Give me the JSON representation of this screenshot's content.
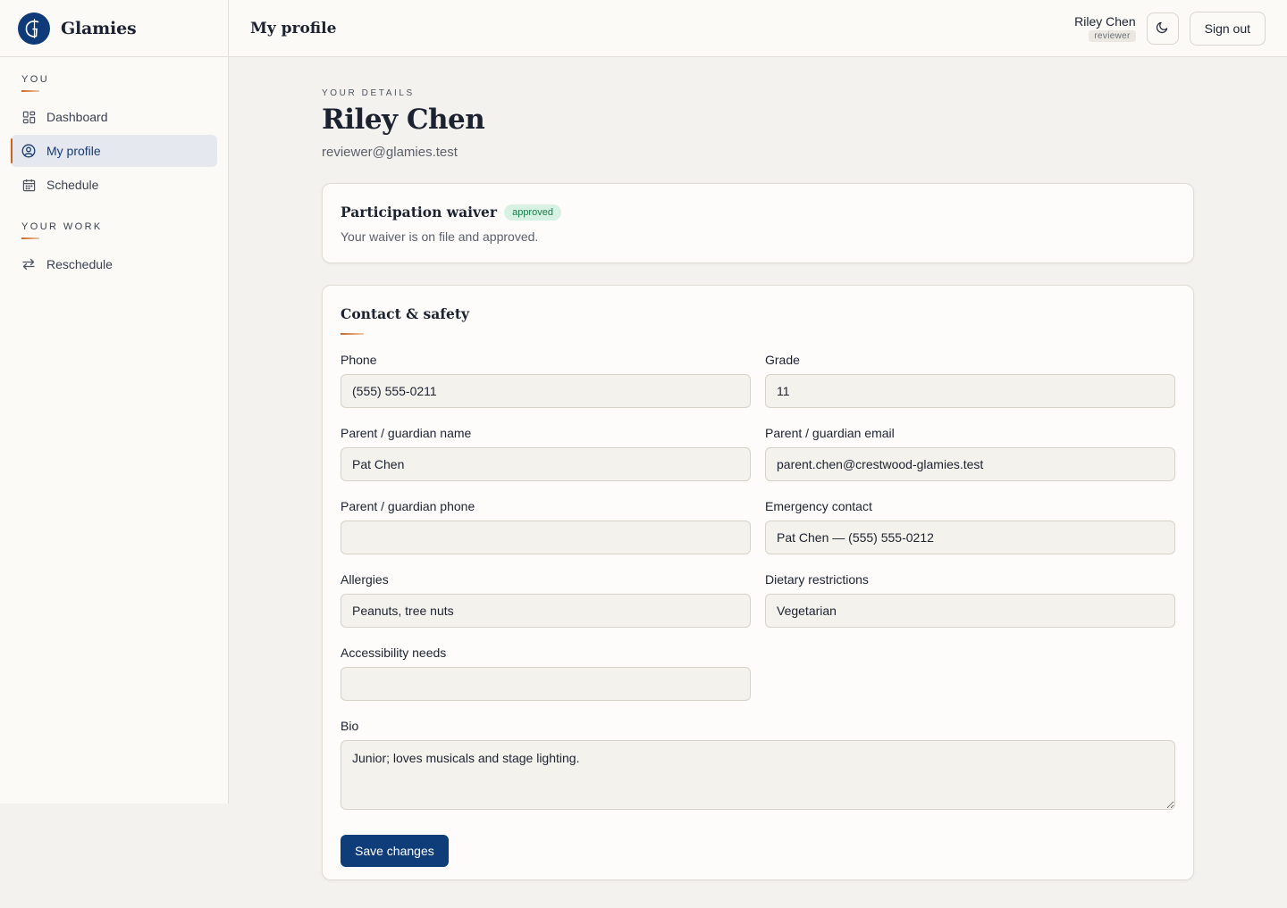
{
  "brand": {
    "name": "Glamies",
    "logo_letter": "G"
  },
  "sidebar": {
    "sections": [
      {
        "heading": "YOU",
        "items": [
          {
            "label": "Dashboard",
            "icon": "grid-icon",
            "active": false
          },
          {
            "label": "My profile",
            "icon": "user-circle-icon",
            "active": true
          },
          {
            "label": "Schedule",
            "icon": "calendar-icon",
            "active": false
          }
        ]
      },
      {
        "heading": "YOUR WORK",
        "items": [
          {
            "label": "Reschedule",
            "icon": "swap-arrows-icon",
            "active": false
          }
        ]
      }
    ]
  },
  "header": {
    "title": "My profile",
    "user_name": "Riley Chen",
    "user_role": "reviewer",
    "theme_icon": "moon-icon",
    "signout_label": "Sign out"
  },
  "main": {
    "eyebrow": "YOUR DETAILS",
    "name": "Riley Chen",
    "email": "reviewer@glamies.test",
    "waiver": {
      "title": "Participation waiver",
      "badge": "approved",
      "text": "Your waiver is on file and approved."
    },
    "contact": {
      "title": "Contact & safety",
      "fields": {
        "phone": {
          "label": "Phone",
          "value": "(555) 555-0211"
        },
        "grade": {
          "label": "Grade",
          "value": "11"
        },
        "guardian_name": {
          "label": "Parent / guardian name",
          "value": "Pat Chen"
        },
        "guardian_email": {
          "label": "Parent / guardian email",
          "value": "parent.chen@crestwood-glamies.test"
        },
        "guardian_phone": {
          "label": "Parent / guardian phone",
          "value": ""
        },
        "emergency_contact": {
          "label": "Emergency contact",
          "value": "Pat Chen — (555) 555-0212"
        },
        "allergies": {
          "label": "Allergies",
          "value": "Peanuts, tree nuts"
        },
        "dietary": {
          "label": "Dietary restrictions",
          "value": "Vegetarian"
        },
        "accessibility": {
          "label": "Accessibility needs",
          "value": ""
        },
        "bio": {
          "label": "Bio",
          "value": "Junior; loves musicals and stage lighting."
        }
      },
      "save_label": "Save changes"
    }
  },
  "colors": {
    "accent": "#0f3d7a",
    "highlight": "#d0641e",
    "badge_bg": "#d7f2e2",
    "badge_text": "#1c7a4a"
  }
}
